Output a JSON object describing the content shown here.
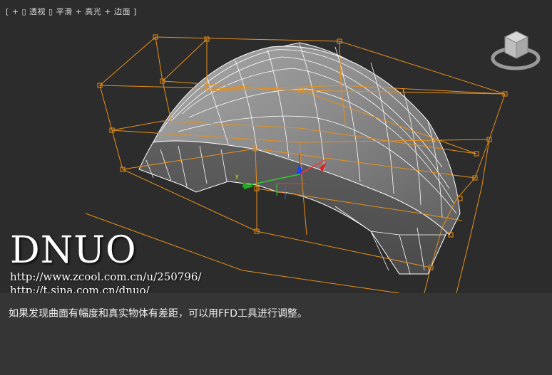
{
  "viewport": {
    "label": "[ + ▯ 透视 ▯ 平滑 + 高光 + 边面 ]"
  },
  "watermark": {
    "title": "DNUO",
    "url1": "http://www.zcool.com.cn/u/250796/",
    "url2": "http://t.sina.com.cn/dnuo/"
  },
  "caption": "如果发现曲面有幅度和真实物体有差距，可以用FFD工具进行调整。",
  "colors": {
    "lattice": "#e8901a",
    "mesh": "#ffffff",
    "viewport_bg": "#2c2c2c",
    "page_bg": "#353535"
  }
}
